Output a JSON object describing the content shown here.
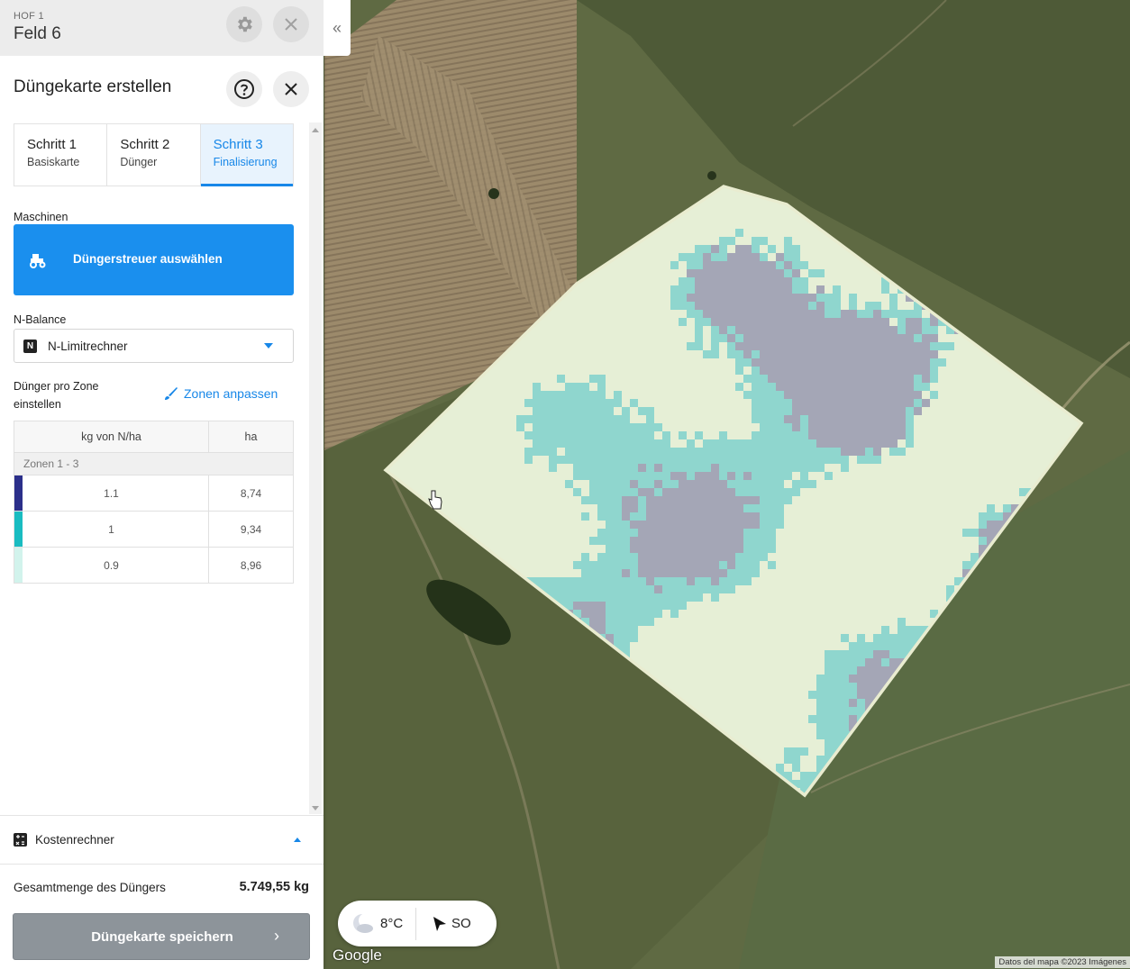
{
  "header": {
    "farm": "HOF 1",
    "field": "Feld 6",
    "collapse_icon": "«"
  },
  "panel": {
    "title": "Düngekarte erstellen"
  },
  "steps": [
    {
      "title": "Schritt 1",
      "subtitle": "Basiskarte",
      "active": false
    },
    {
      "title": "Schritt 2",
      "subtitle": "Dünger",
      "active": false
    },
    {
      "title": "Schritt 3",
      "subtitle": "Finalisierung",
      "active": true
    }
  ],
  "machines": {
    "label": "Maschinen",
    "button_label": "Düngerstreuer auswählen"
  },
  "n_balance": {
    "label": "N-Balance",
    "badge": "N",
    "selected": "N-Limitrechner"
  },
  "zones": {
    "label": "Dünger pro Zone einstellen",
    "adjust_link": "Zonen anpassen",
    "col_rate": "kg von N/ha",
    "col_area": "ha",
    "group_label": "Zonen 1 - 3",
    "rows": [
      {
        "rate": "1.1",
        "area": "8,74",
        "color": "#2b2f8a"
      },
      {
        "rate": "1",
        "area": "9,34",
        "color": "#19bcc1"
      },
      {
        "rate": "0.9",
        "area": "8,96",
        "color": "#d2f3ec"
      }
    ]
  },
  "cost_calculator": {
    "label": "Kostenrechner",
    "total_label": "Gesamtmenge des Düngers",
    "total_value": "5.749,55 kg"
  },
  "save_button": {
    "label": "Düngekarte speichern",
    "arrow": "›"
  },
  "weather": {
    "temperature": "8°C",
    "wind_direction": "SO"
  },
  "map": {
    "provider_logo": "Google",
    "attribution": "Datos del mapa ©2023 Imágenes",
    "zone_colors": {
      "low": "#e6efd6",
      "mid": "#8fd6ce",
      "high": "#a4a6b6"
    }
  },
  "colors": {
    "accent": "#1787e8",
    "button_blue": "#1a8fee",
    "save_button_disabled": "#8d949a"
  }
}
